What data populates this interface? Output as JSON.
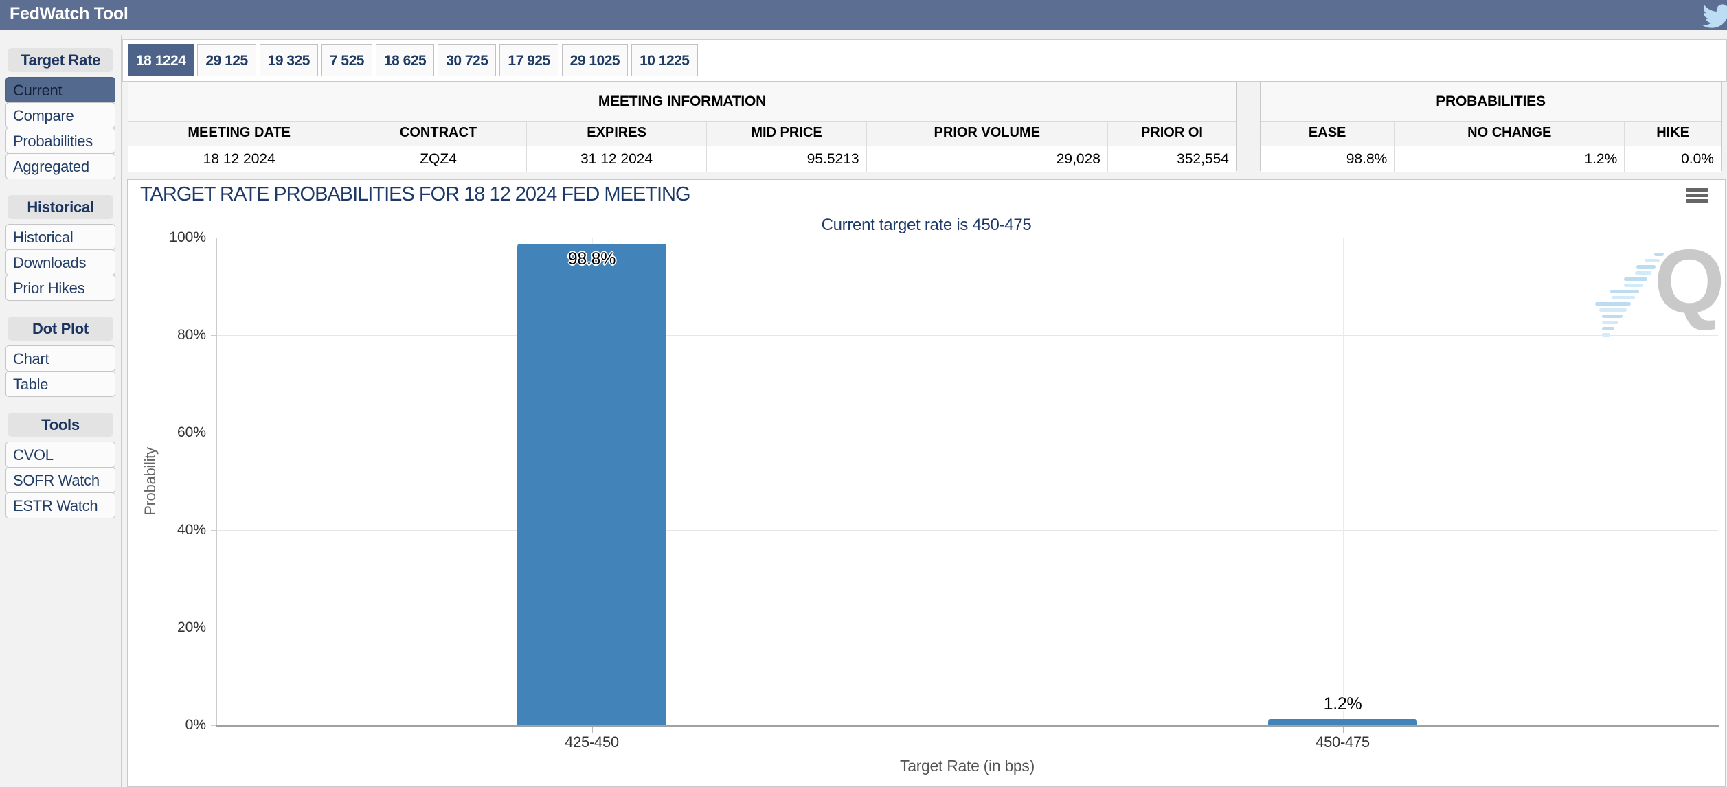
{
  "header": {
    "title": "FedWatch Tool"
  },
  "colors": {
    "header_bar": "#5C6F93",
    "accent": "#51678F",
    "bar": "#4283BA",
    "navy": "#1E3A68",
    "bird_icon": "#BCDDF4"
  },
  "sidebar": {
    "sections": [
      {
        "label": "Target Rate",
        "items": [
          {
            "label": "Current",
            "selected": true
          },
          {
            "label": "Compare",
            "selected": false
          },
          {
            "label": "Probabilities",
            "selected": false
          },
          {
            "label": "Aggregated",
            "selected": false
          }
        ]
      },
      {
        "label": "Historical",
        "items": [
          {
            "label": "Historical",
            "selected": false
          },
          {
            "label": "Downloads",
            "selected": false
          },
          {
            "label": "Prior Hikes",
            "selected": false
          }
        ]
      },
      {
        "label": "Dot Plot",
        "items": [
          {
            "label": "Chart",
            "selected": false
          },
          {
            "label": "Table",
            "selected": false
          }
        ]
      },
      {
        "label": "Tools",
        "items": [
          {
            "label": "CVOL",
            "selected": false
          },
          {
            "label": "SOFR Watch",
            "selected": false
          },
          {
            "label": "ESTR Watch",
            "selected": false
          }
        ]
      }
    ]
  },
  "tabs": [
    {
      "label": "18 1224",
      "selected": true
    },
    {
      "label": "29 125",
      "selected": false
    },
    {
      "label": "19 325",
      "selected": false
    },
    {
      "label": "7 525",
      "selected": false
    },
    {
      "label": "18 625",
      "selected": false
    },
    {
      "label": "30 725",
      "selected": false
    },
    {
      "label": "17 925",
      "selected": false
    },
    {
      "label": "29 1025",
      "selected": false
    },
    {
      "label": "10 1225",
      "selected": false
    }
  ],
  "meeting_info": {
    "title": "MEETING INFORMATION",
    "columns": [
      "MEETING DATE",
      "CONTRACT",
      "EXPIRES",
      "MID PRICE",
      "PRIOR VOLUME",
      "PRIOR OI"
    ],
    "values": [
      "18 12 2024",
      "ZQZ4",
      "31 12 2024",
      "95.5213",
      "29,028",
      "352,554"
    ]
  },
  "probabilities": {
    "title": "PROBABILITIES",
    "columns": [
      "EASE",
      "NO CHANGE",
      "HIKE"
    ],
    "values": [
      "98.8%",
      "1.2%",
      "0.0%"
    ]
  },
  "chart": {
    "title": "TARGET RATE PROBABILITIES FOR 18 12 2024 FED MEETING",
    "subtitle": "Current target rate is 450-475",
    "menu_icon": "hamburger-menu-icon",
    "watermark_letter": "Q"
  },
  "chart_data": {
    "type": "bar",
    "title": "TARGET RATE PROBABILITIES FOR 18 12 2024 FED MEETING",
    "subtitle": "Current target rate is 450-475",
    "categories": [
      "425-450",
      "450-475"
    ],
    "values": [
      98.8,
      1.2
    ],
    "bar_labels": [
      "98.8%",
      "1.2%"
    ],
    "xlabel": "Target Rate (in bps)",
    "ylabel": "Probability",
    "ylim": [
      0,
      100
    ],
    "yticks": [
      0,
      20,
      40,
      60,
      80,
      100
    ],
    "ytick_labels": [
      "0%",
      "20%",
      "40%",
      "60%",
      "80%",
      "100%"
    ],
    "grid": true,
    "legend_position": "none",
    "bar_color": "#4283BA"
  }
}
